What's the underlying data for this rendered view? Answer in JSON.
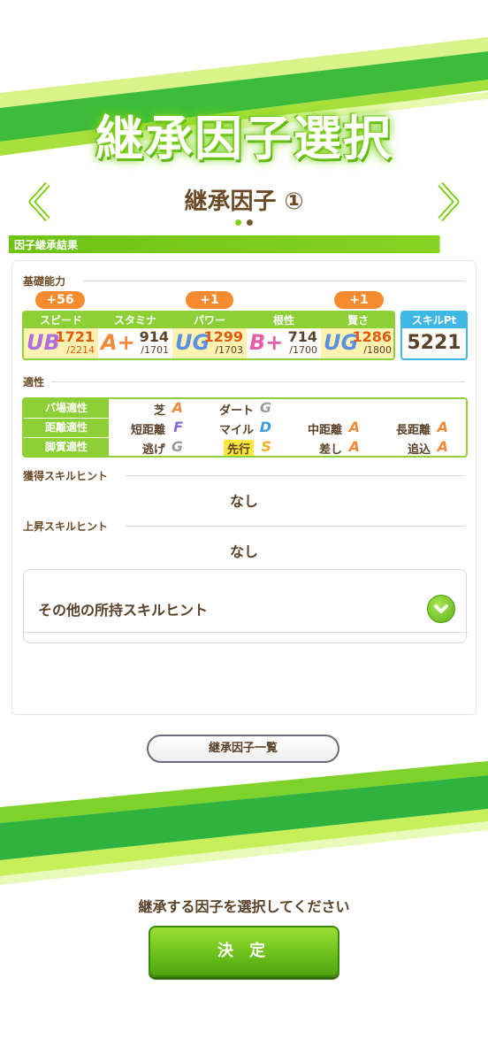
{
  "header": {
    "title": "継承因子選択",
    "subtitle": "継承因子 ①"
  },
  "section": {
    "title": "因子継承結果"
  },
  "basic": {
    "label": "基礎能力",
    "stats": [
      {
        "name": "スピード",
        "rank": "UB",
        "value": "1721",
        "max": "/2214",
        "bonus": "+56",
        "highlight": true
      },
      {
        "name": "スタミナ",
        "rank": "A+",
        "value": "914",
        "max": "/1701",
        "bonus": "",
        "highlight": false
      },
      {
        "name": "パワー",
        "rank": "UG",
        "value": "1299",
        "max": "/1703",
        "bonus": "+1",
        "highlight": true
      },
      {
        "name": "根性",
        "rank": "B+",
        "value": "714",
        "max": "/1700",
        "bonus": "",
        "highlight": false
      },
      {
        "name": "賢さ",
        "rank": "UG",
        "value": "1286",
        "max": "/1800",
        "bonus": "+1",
        "highlight": true
      }
    ],
    "skill_pt_label": "スキルPt",
    "skill_pt_value": "5221"
  },
  "aptitude": {
    "label": "適性",
    "rows": [
      {
        "header": "バ場適性",
        "cells": [
          {
            "label": "芝",
            "grade": "A"
          },
          {
            "label": "ダート",
            "grade": "G"
          }
        ]
      },
      {
        "header": "距離適性",
        "cells": [
          {
            "label": "短距離",
            "grade": "F"
          },
          {
            "label": "マイル",
            "grade": "D"
          },
          {
            "label": "中距離",
            "grade": "A"
          },
          {
            "label": "長距離",
            "grade": "A"
          }
        ]
      },
      {
        "header": "脚質適性",
        "cells": [
          {
            "label": "逃げ",
            "grade": "G"
          },
          {
            "label": "先行",
            "grade": "S"
          },
          {
            "label": "差し",
            "grade": "A"
          },
          {
            "label": "追込",
            "grade": "A"
          }
        ]
      }
    ]
  },
  "acquired": {
    "label": "獲得スキルヒント",
    "value": "なし"
  },
  "raised": {
    "label": "上昇スキルヒント",
    "value": "なし"
  },
  "other": {
    "label": "その他の所持スキルヒント"
  },
  "list_button": "継承因子一覧",
  "instruction": "継承する因子を選択してください",
  "decide_button": "決 定",
  "colors": {
    "green": "#7fcf1f",
    "orange": "#f58a2e",
    "blue": "#3fb7e6",
    "brown": "#6b4a25"
  }
}
